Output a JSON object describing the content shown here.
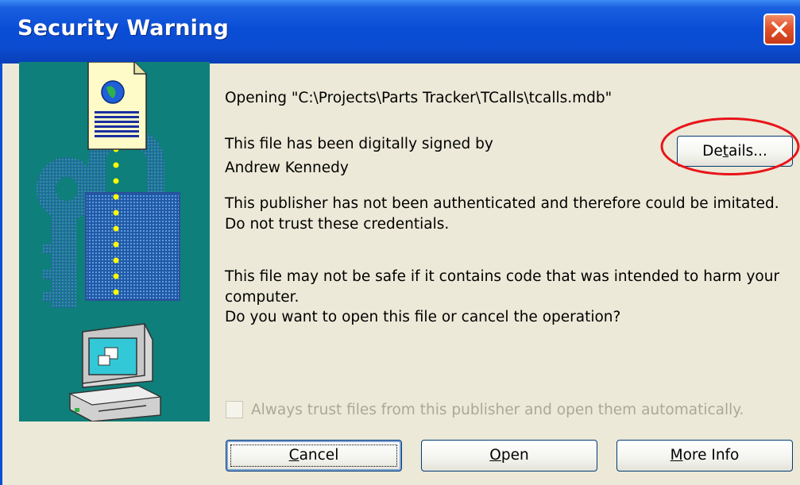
{
  "window": {
    "title": "Security Warning",
    "close_icon": "close-x-icon"
  },
  "message": {
    "opening": "Opening \"C:\\Projects\\Parts Tracker\\TCalls\\tcalls.mdb\"",
    "signed_line1": "This file has been digitally signed by",
    "signed_line2": "Andrew Kennedy",
    "publisher_line1": "This publisher has not been authenticated and therefore could be imitated.",
    "publisher_line2": "Do not trust these credentials.",
    "warning_line1": "This file may not be safe if it contains code that was intended to harm your",
    "warning_line2": "computer.",
    "warning_line3": "Do you want to open this file or cancel the operation?"
  },
  "details_button": {
    "label_pre": "De",
    "label_mnemonic": "t",
    "label_post": "ails..."
  },
  "trust_checkbox": {
    "label": "Always trust files from this publisher and open them automatically.",
    "checked": false,
    "enabled": false
  },
  "buttons": {
    "cancel": {
      "label_mnemonic": "C",
      "label_post": "ancel"
    },
    "open": {
      "label_mnemonic": "O",
      "label_post": "pen"
    },
    "more_info": {
      "label_pre": "",
      "label_mnemonic": "M",
      "label_post": "ore Info"
    }
  },
  "illustration": {
    "icons": [
      "document-globe-icon",
      "padlock-icon",
      "keys-icon",
      "computer-icon"
    ]
  },
  "colors": {
    "titlebar": "#0a4ed6",
    "dialog_bg": "#ece9d8",
    "art_bg": "#0e7f7a",
    "annotation": "#e8141a"
  }
}
